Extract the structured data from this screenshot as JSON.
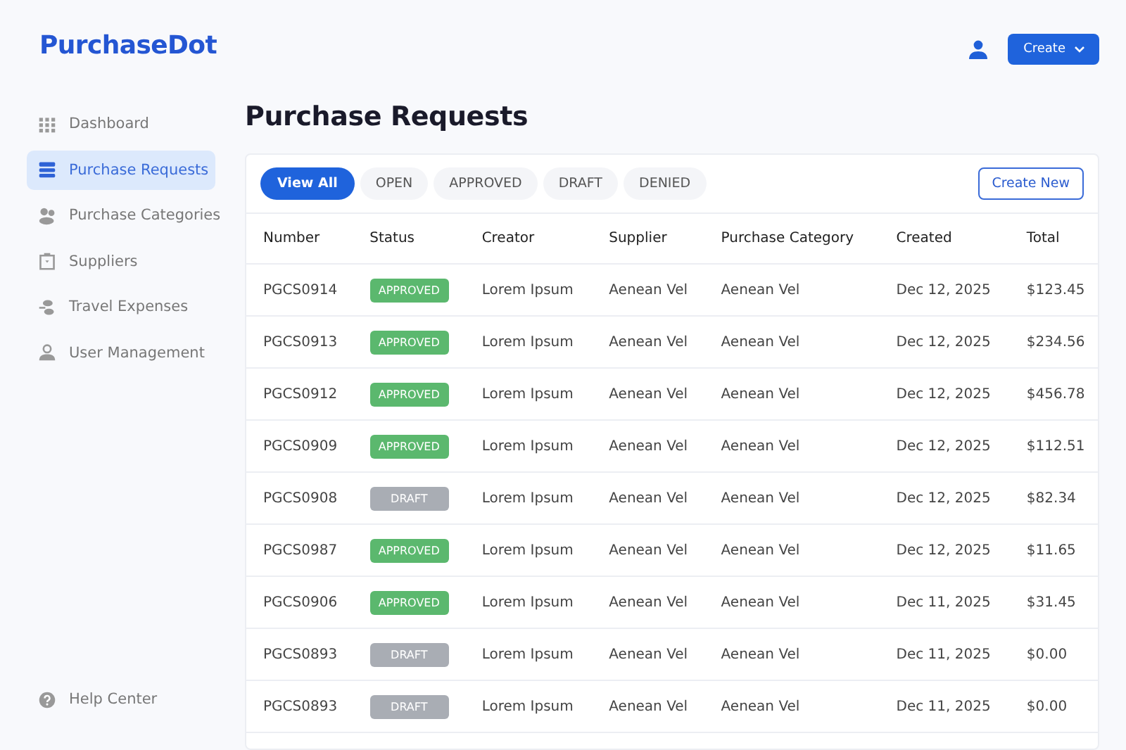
{
  "brand": "PurchaseDot",
  "sidebar": {
    "items": [
      {
        "label": "Dashboard",
        "selected": false
      },
      {
        "label": "Purchase Requests",
        "selected": true
      },
      {
        "label": "Purchase Categories",
        "selected": false
      },
      {
        "label": "Suppliers",
        "selected": false
      },
      {
        "label": "Travel Expenses",
        "selected": false
      },
      {
        "label": "User Management",
        "selected": false
      }
    ],
    "help": "Help Center"
  },
  "header": {
    "create_button": "Create"
  },
  "page_title": "Purchase Requests",
  "filters": [
    {
      "label": "View All",
      "selected": true
    },
    {
      "label": "OPEN",
      "selected": false
    },
    {
      "label": "APPROVED",
      "selected": false
    },
    {
      "label": "DRAFT",
      "selected": false
    },
    {
      "label": "DENIED",
      "selected": false
    }
  ],
  "create_new": "Create New",
  "table": {
    "columns": [
      "Number",
      "Status",
      "Creator",
      "Supplier",
      "Purchase Category",
      "Created",
      "Total"
    ],
    "rows": [
      {
        "number": "PGCS0914",
        "status": {
          "label": "APPROVED",
          "kind": "approved"
        },
        "creator": "Lorem Ipsum",
        "supplier": "Aenean Vel",
        "category": "Aenean Vel",
        "created": "Dec 12, 2025",
        "total": "$123.45"
      },
      {
        "number": "PGCS0913",
        "status": {
          "label": "APPROVED",
          "kind": "approved"
        },
        "creator": "Lorem Ipsum",
        "supplier": "Aenean Vel",
        "category": "Aenean Vel",
        "created": "Dec 12, 2025",
        "total": "$234.56"
      },
      {
        "number": "PGCS0912",
        "status": {
          "label": "APPROVED",
          "kind": "approved"
        },
        "creator": "Lorem Ipsum",
        "supplier": "Aenean Vel",
        "category": "Aenean Vel",
        "created": "Dec 12, 2025",
        "total": "$456.78"
      },
      {
        "number": "PGCS0909",
        "status": {
          "label": "APPROVED",
          "kind": "approved"
        },
        "creator": "Lorem Ipsum",
        "supplier": "Aenean Vel",
        "category": "Aenean Vel",
        "created": "Dec 12, 2025",
        "total": "$112.51"
      },
      {
        "number": "PGCS0908",
        "status": {
          "label": "DRAFT",
          "kind": "draft"
        },
        "creator": "Lorem Ipsum",
        "supplier": "Aenean Vel",
        "category": "Aenean Vel",
        "created": "Dec 12, 2025",
        "total": "$82.34"
      },
      {
        "number": "PGCS0987",
        "status": {
          "label": "APPROVED",
          "kind": "approved"
        },
        "creator": "Lorem Ipsum",
        "supplier": "Aenean Vel",
        "category": "Aenean Vel",
        "created": "Dec 12, 2025",
        "total": "$11.65"
      },
      {
        "number": "PGCS0906",
        "status": {
          "label": "APPROVED",
          "kind": "approved"
        },
        "creator": "Lorem Ipsum",
        "supplier": "Aenean Vel",
        "category": "Aenean Vel",
        "created": "Dec 11, 2025",
        "total": "$31.45"
      },
      {
        "number": "PGCS0893",
        "status": {
          "label": "DRAFT",
          "kind": "draft"
        },
        "creator": "Lorem Ipsum",
        "supplier": "Aenean Vel",
        "category": "Aenean Vel",
        "created": "Dec 11, 2025",
        "total": "$0.00"
      },
      {
        "number": "PGCS0893",
        "status": {
          "label": "DRAFT",
          "kind": "draft"
        },
        "creator": "Lorem Ipsum",
        "supplier": "Aenean Vel",
        "category": "Aenean Vel",
        "created": "Dec 11, 2025",
        "total": "$0.00"
      }
    ]
  }
}
